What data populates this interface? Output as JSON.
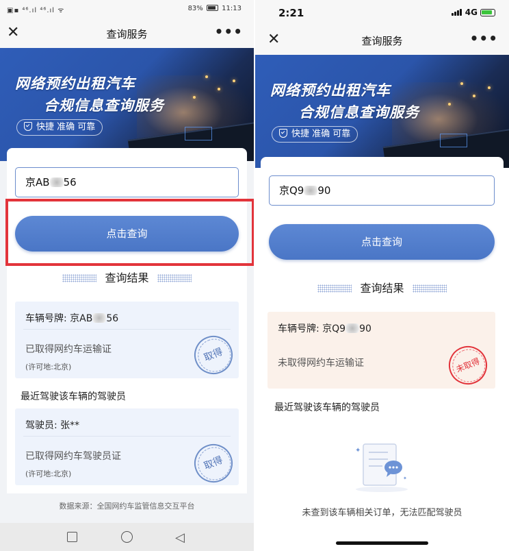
{
  "left": {
    "status": {
      "left": "▣▪ ⁴⁶.ıl ⁴⁶.ıl ᯤ",
      "battery": "83%",
      "time": "11:13"
    },
    "nav": {
      "close": "✕",
      "title": "查询服务",
      "more": "•••"
    },
    "banner": {
      "line1": "网络预约出租汽车",
      "line2": "合规信息查询服务",
      "badge": "快捷  准确  可靠"
    },
    "plate_input": {
      "prefix": "京AB",
      "suffix": "56"
    },
    "query_button": "点击查询",
    "result_title": "查询结果",
    "vehicle": {
      "plate_label": "车辆号牌: 京AB",
      "plate_suffix": "56",
      "status": "已取得网约车运输证",
      "permit": "(许可地:北京)",
      "stamp": "取得"
    },
    "drivers_label": "最近驾驶该车辆的驾驶员",
    "driver": {
      "name": "驾驶员: 张**",
      "status": "已取得网约车驾驶员证",
      "permit": "(许可地:北京)",
      "stamp": "取得"
    },
    "source": "数据来源：全国网约车监管信息交互平台"
  },
  "right": {
    "status": {
      "time": "2:21",
      "network": "4G"
    },
    "nav": {
      "close": "✕",
      "title": "查询服务",
      "more": "•••"
    },
    "banner": {
      "line1": "网络预约出租汽车",
      "line2": "合规信息查询服务",
      "badge": "快捷  准确  可靠"
    },
    "plate_input": {
      "prefix": "京Q9",
      "suffix": "90"
    },
    "query_button": "点击查询",
    "result_title": "查询结果",
    "vehicle": {
      "plate_label": "车辆号牌: 京Q9",
      "plate_suffix": "90",
      "status": "未取得网约车运输证",
      "stamp": "未取得"
    },
    "drivers_label": "最近驾驶该车辆的驾驶员",
    "empty_text": "未查到该车辆相关订单，无法匹配驾驶员"
  },
  "colors": {
    "accent": "#4a76c6",
    "highlight": "#e2343b",
    "info_bg": "#eef3fc",
    "warn_bg": "#fbf1ea"
  }
}
